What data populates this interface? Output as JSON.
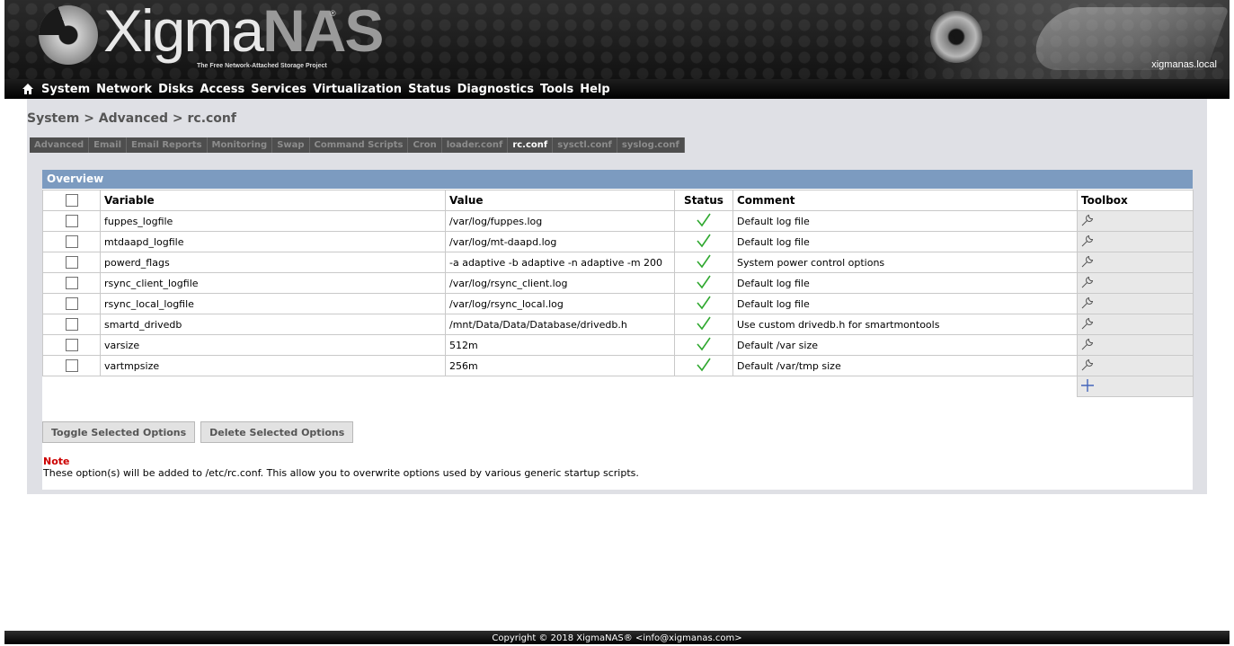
{
  "header": {
    "logo_main": "Xigma",
    "logo_accent": "NAS",
    "logo_mark": "®",
    "tagline": "The Free Network-Attached Storage Project",
    "hostname": "xigmanas.local"
  },
  "menu": {
    "home_icon": "home-icon",
    "items": [
      {
        "label": "System"
      },
      {
        "label": "Network"
      },
      {
        "label": "Disks"
      },
      {
        "label": "Access"
      },
      {
        "label": "Services"
      },
      {
        "label": "Virtualization"
      },
      {
        "label": "Status"
      },
      {
        "label": "Diagnostics"
      },
      {
        "label": "Tools"
      },
      {
        "label": "Help"
      }
    ]
  },
  "breadcrumb": "System > Advanced > rc.conf",
  "tabs": [
    {
      "label": "Advanced",
      "active": false
    },
    {
      "label": "Email",
      "active": false
    },
    {
      "label": "Email Reports",
      "active": false
    },
    {
      "label": "Monitoring",
      "active": false
    },
    {
      "label": "Swap",
      "active": false
    },
    {
      "label": "Command Scripts",
      "active": false
    },
    {
      "label": "Cron",
      "active": false
    },
    {
      "label": "loader.conf",
      "active": false
    },
    {
      "label": "rc.conf",
      "active": true
    },
    {
      "label": "sysctl.conf",
      "active": false
    },
    {
      "label": "syslog.conf",
      "active": false
    }
  ],
  "panel": {
    "title": "Overview",
    "columns": {
      "variable": "Variable",
      "value": "Value",
      "status": "Status",
      "comment": "Comment",
      "toolbox": "Toolbox"
    },
    "rows": [
      {
        "variable": "fuppes_logfile",
        "value": "/var/log/fuppes.log",
        "status": "enabled",
        "comment": "Default log file"
      },
      {
        "variable": "mtdaapd_logfile",
        "value": "/var/log/mt-daapd.log",
        "status": "enabled",
        "comment": "Default log file"
      },
      {
        "variable": "powerd_flags",
        "value": "-a adaptive -b adaptive -n adaptive -m 200",
        "status": "enabled",
        "comment": "System power control options"
      },
      {
        "variable": "rsync_client_logfile",
        "value": "/var/log/rsync_client.log",
        "status": "enabled",
        "comment": "Default log file"
      },
      {
        "variable": "rsync_local_logfile",
        "value": "/var/log/rsync_local.log",
        "status": "enabled",
        "comment": "Default log file"
      },
      {
        "variable": "smartd_drivedb",
        "value": "/mnt/Data/Data/Database/drivedb.h",
        "status": "enabled",
        "comment": "Use custom drivedb.h for smartmontools"
      },
      {
        "variable": "varsize",
        "value": "512m",
        "status": "enabled",
        "comment": "Default /var size"
      },
      {
        "variable": "vartmpsize",
        "value": "256m",
        "status": "enabled",
        "comment": "Default /var/tmp size"
      }
    ],
    "status_icon": "checkmark-icon",
    "edit_icon": "wrench-icon",
    "add_icon": "plus-icon"
  },
  "buttons": {
    "toggle": "Toggle Selected Options",
    "delete": "Delete Selected Options"
  },
  "note": {
    "title": "Note",
    "text": "These option(s) will be added to /etc/rc.conf. This allow you to overwrite options used by various generic startup scripts."
  },
  "footer": "Copyright © 2018 XigmaNAS® <info@xigmanas.com>",
  "colors": {
    "panel_header": "#7c9bc0",
    "check_green": "#2fa82f",
    "note_red": "#cc0000",
    "page_bg": "#dfe0e5",
    "add_blue": "#4466bb"
  }
}
